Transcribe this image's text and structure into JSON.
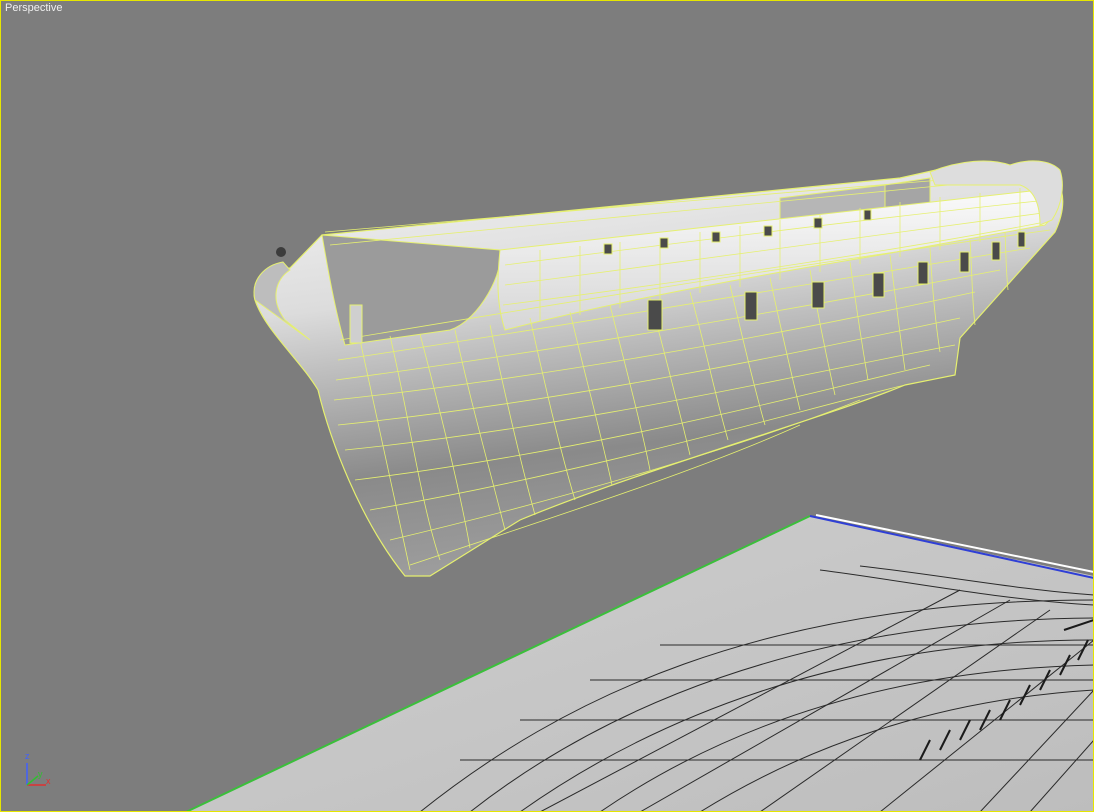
{
  "viewport": {
    "label": "Perspective",
    "background_color": "#7d7d7d",
    "border_color": "#e6e600"
  },
  "scene": {
    "selection_wire_color": "#e6f070",
    "hull_color_light": "#efefef",
    "hull_color_dark": "#5c5c5c",
    "plane_color": "#c8c8c8",
    "plane_line_color": "#2a2a2a"
  },
  "axis_tripod": {
    "x_label": "x",
    "y_label": "y",
    "z_label": "z",
    "x_color": "#e03030",
    "y_color": "#30c030",
    "z_color": "#4060ff"
  }
}
